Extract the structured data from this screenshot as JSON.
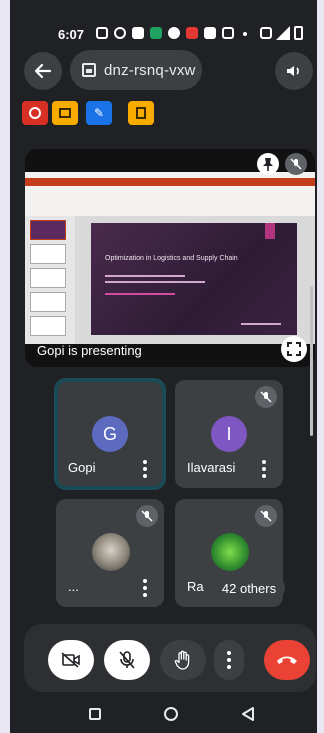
{
  "status_bar": {
    "time": "6:07"
  },
  "header": {
    "meeting_code": "dnz-rsnq-vxw"
  },
  "presentation": {
    "slide_title": "Optimization in Logistics and Supply Chain",
    "presenter_text": "Gopi is presenting"
  },
  "participants": [
    {
      "name": "Gopi",
      "initial": "G",
      "avatar_color": "#5c6bc0"
    },
    {
      "name": "Ilavarasi",
      "initial": "I",
      "avatar_color": "#7e57c2"
    },
    {
      "name": "...",
      "initial": ""
    },
    {
      "name": "Ra",
      "initial": ""
    }
  ],
  "others_badge": "42 others",
  "colors": {
    "background": "#202124",
    "surface": "#3c4043",
    "end_call": "#ea4335",
    "active_tile_border": "#174a52"
  },
  "icons": [
    "back-arrow-icon",
    "calendar-icon",
    "speaker-icon",
    "camera-off-icon",
    "mic-off-icon",
    "raise-hand-icon",
    "more-options-icon",
    "end-call-icon",
    "pin-icon",
    "fullscreen-icon"
  ]
}
